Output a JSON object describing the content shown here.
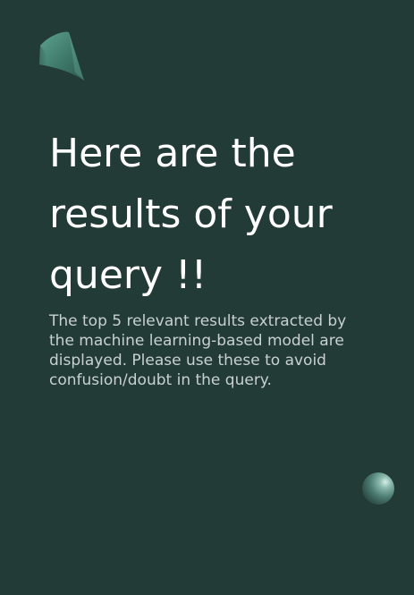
{
  "headline": {
    "text": "Here are the results of your query !!"
  },
  "description": {
    "text": "The top 5 relevant results extracted by the machine learning-based model are displayed. Please use these to avoid confusion/doubt in the query."
  },
  "decorations": {
    "cone_icon": "cone-shape",
    "sphere_icon": "sphere-shape"
  },
  "colors": {
    "background": "#233b36",
    "headline": "#ffffff",
    "description": "#c8d1cf",
    "accent": "#4f8d7c"
  }
}
